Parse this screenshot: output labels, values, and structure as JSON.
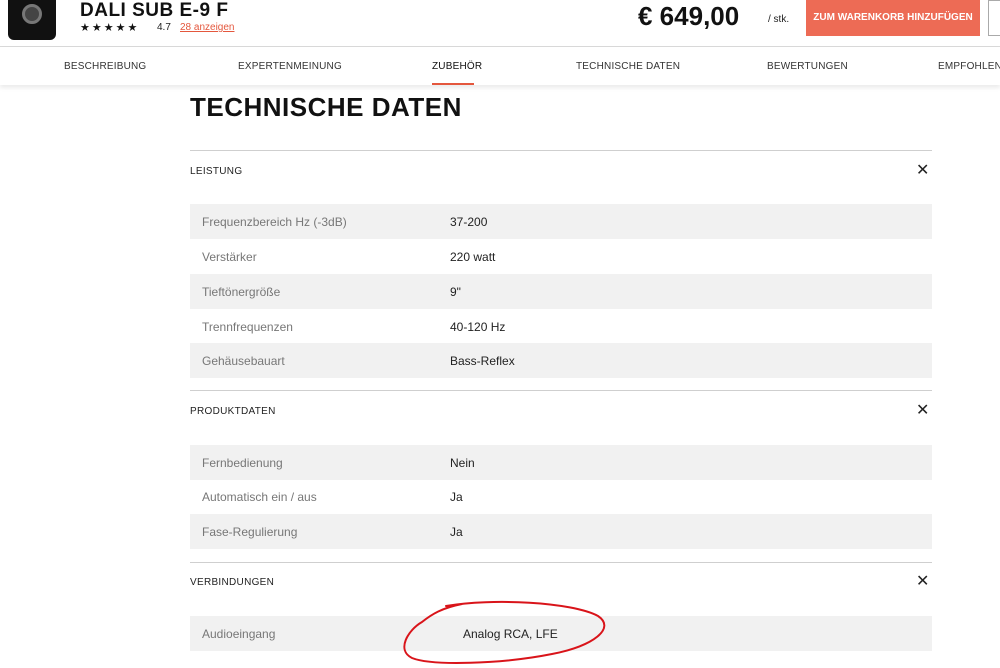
{
  "product": {
    "name": "DALI SUB E-9 F",
    "stars": "★★★★★",
    "rating": "4.7",
    "reviews_link": "28 anzeigen",
    "price": "€ 649,00",
    "unit": "/ stk.",
    "cart_button": "ZUM WARENKORB HINZUFÜGEN"
  },
  "tabs": [
    {
      "label": "BESCHREIBUNG"
    },
    {
      "label": "EXPERTENMEINUNG"
    },
    {
      "label": "ZUBEHÖR",
      "active": true
    },
    {
      "label": "TECHNISCHE DATEN"
    },
    {
      "label": "BEWERTUNGEN"
    },
    {
      "label": "EMPFOHLENE"
    }
  ],
  "page_title": "TECHNISCHE DATEN",
  "sections": [
    {
      "title": "LEISTUNG",
      "rows": [
        {
          "key": "Frequenzbereich Hz (-3dB)",
          "value": "37-200"
        },
        {
          "key": "Verstärker",
          "value": "220 watt"
        },
        {
          "key": "Tieftönergröße",
          "value": "9\""
        },
        {
          "key": "Trennfrequenzen",
          "value": "40-120 Hz"
        },
        {
          "key": "Gehäusebauart",
          "value": "Bass-Reflex"
        }
      ]
    },
    {
      "title": "PRODUKTDATEN",
      "rows": [
        {
          "key": "Fernbedienung",
          "value": "Nein"
        },
        {
          "key": "Automatisch ein / aus",
          "value": "Ja"
        },
        {
          "key": "Fase-Regulierung",
          "value": "Ja"
        }
      ]
    },
    {
      "title": "VERBINDUNGEN",
      "rows": [
        {
          "key": "Audioeingang",
          "value": "Analog RCA, LFE"
        }
      ]
    }
  ],
  "close_glyph": "✕",
  "colors": {
    "accent": "#ed6b55",
    "row_shade": "#f1f1f1",
    "annotation": "#d9141a"
  }
}
